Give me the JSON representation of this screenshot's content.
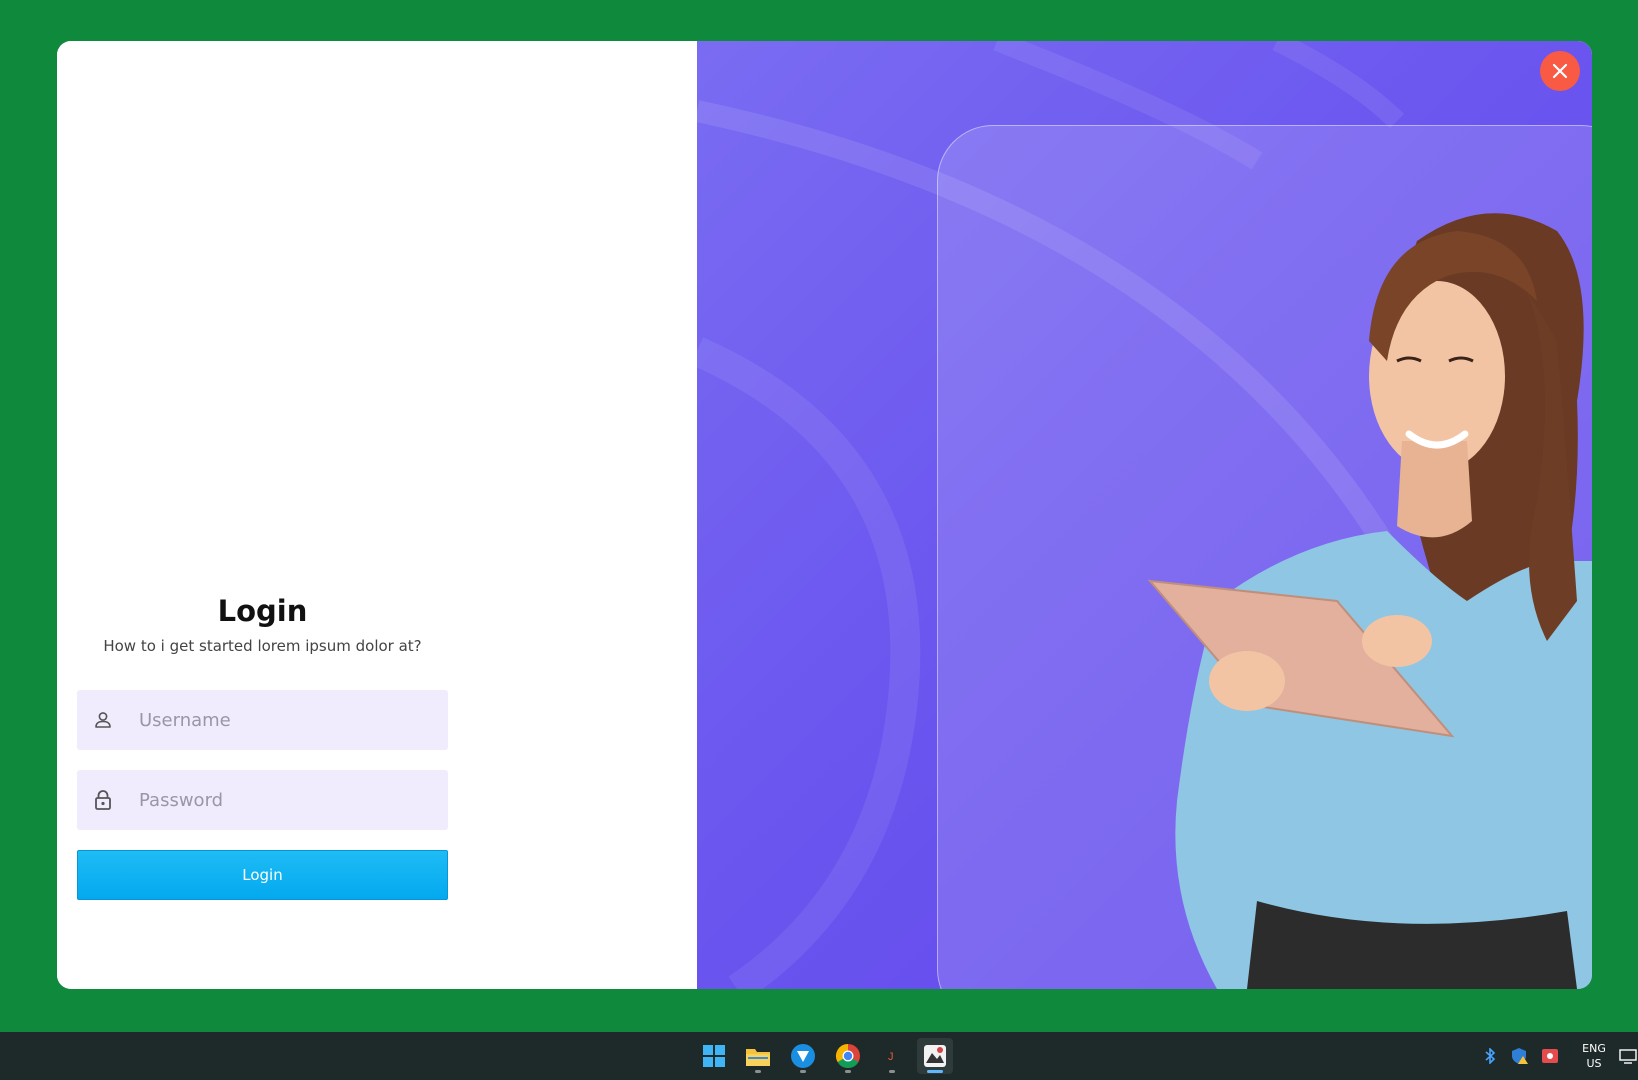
{
  "login": {
    "title": "Login",
    "subtitle": "How to i get started lorem ipsum dolor at?",
    "username_placeholder": "Username",
    "password_placeholder": "Password",
    "button_label": "Login"
  },
  "icons": {
    "username": "user-icon",
    "password": "lock-icon",
    "close": "close-icon"
  },
  "colors": {
    "background": "#0f8a3c",
    "panel_purple": "#6b56ef",
    "field_bg": "#f0ecfd",
    "button": "#0aaef0",
    "close": "#f85a44"
  },
  "taskbar": {
    "apps": [
      "windows-start",
      "file-explorer",
      "vpn-app",
      "chrome",
      "java-app",
      "image-app"
    ],
    "tray": {
      "lang_line1": "ENG",
      "lang_line2": "US"
    }
  }
}
